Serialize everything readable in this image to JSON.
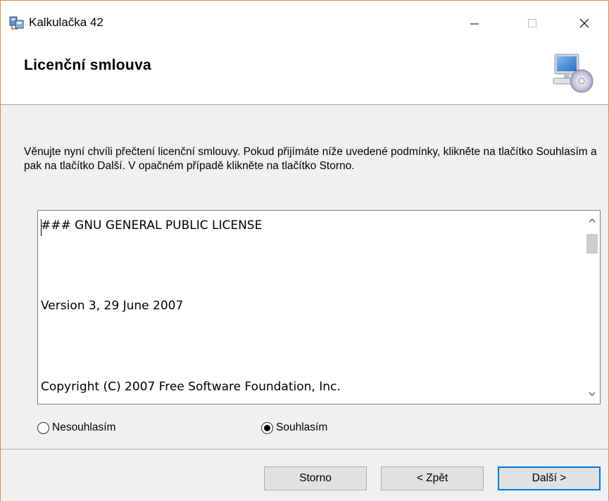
{
  "window": {
    "title": "Kalkulačka 42",
    "icons": {
      "app": "installer-icon",
      "minimize": "minimize-icon",
      "maximize": "maximize-icon",
      "close": "close-icon"
    }
  },
  "header": {
    "title": "Licenční smlouva",
    "icon": "computer-cd-icon"
  },
  "instructions": "Věnujte nyní chvíli přečtení licenční smlouvy. Pokud přijímáte níže uvedené podmínky, klikněte na tlačítko Souhlasím a pak na tlačítko Další. V opačném případě klikněte na tlačítko Storno.",
  "license": {
    "lines": [
      "### GNU GENERAL PUBLIC LICENSE",
      "Version 3, 29 June 2007",
      "Copyright (C) 2007 Free Software Foundation, Inc."
    ]
  },
  "options": {
    "disagree_label": "Nesouhlasím",
    "agree_label": "Souhlasím",
    "selected": "agree"
  },
  "buttons": {
    "cancel": "Storno",
    "back": "< Zpět",
    "next": "Další >"
  },
  "colors": {
    "window_border": "#e08b3a",
    "default_button_border": "#0078d7",
    "background": "#f0f0f0"
  }
}
